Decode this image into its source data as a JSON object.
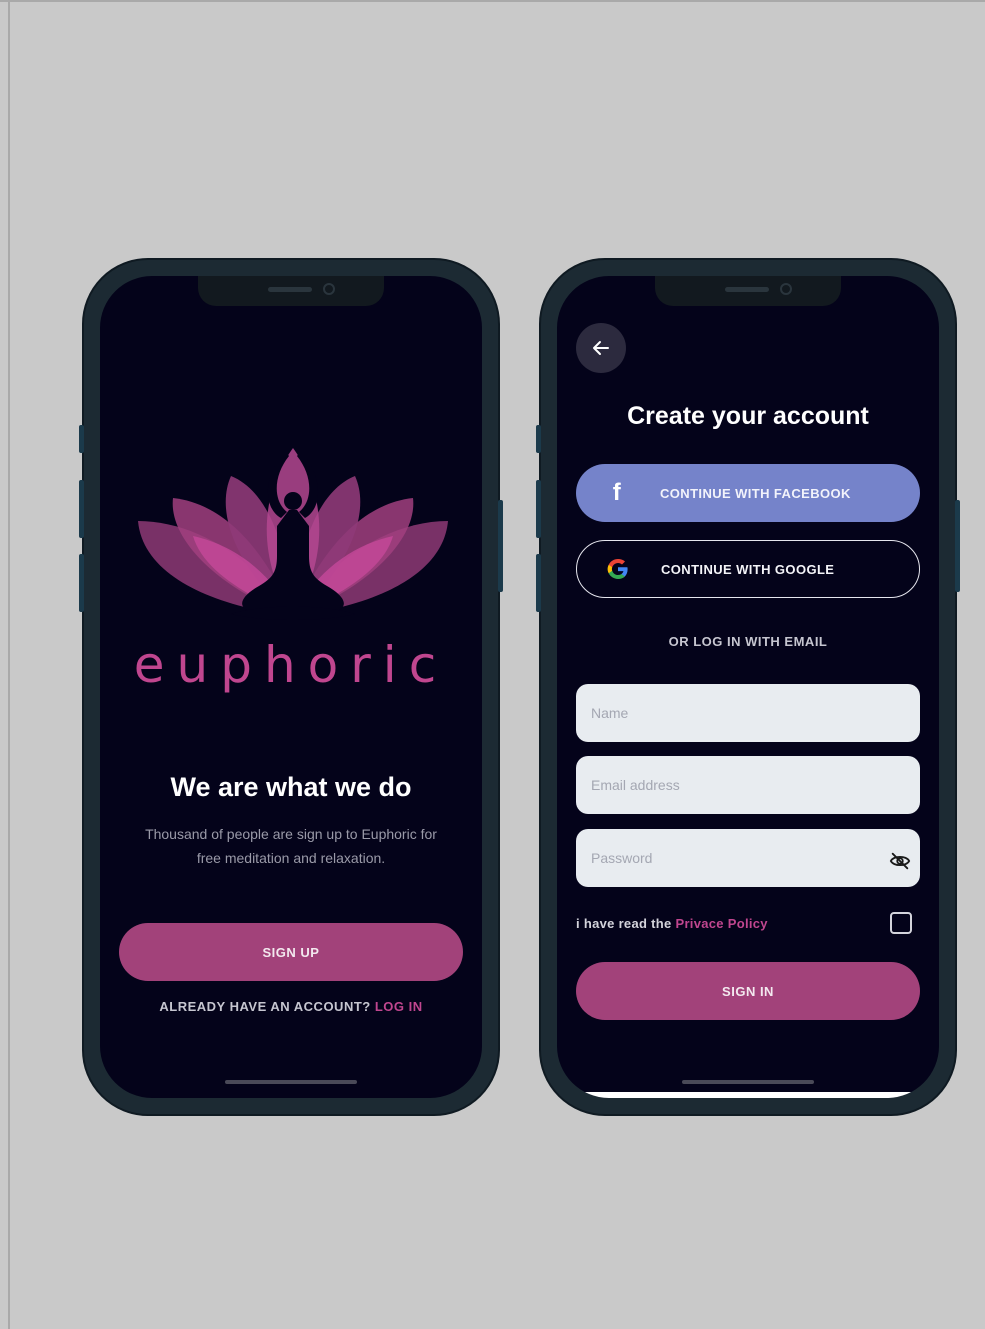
{
  "welcome_screen": {
    "brand_name": "euphoric",
    "tagline": "We are what we do",
    "description": "Thousand of people are sign up to Euphoric for free meditation and relaxation.",
    "signup_label": "SIGN UP",
    "already_text": "ALREADY HAVE AN ACCOUNT?",
    "login_link": "LOG IN"
  },
  "signup_screen": {
    "back_icon": "arrow-left-icon",
    "title": "Create your account",
    "facebook_label": "CONTINUE WITH FACEBOOK",
    "google_label": "CONTINUE WITH GOOGLE",
    "or_text": "OR LOG IN WITH EMAIL",
    "name_placeholder": "Name",
    "email_placeholder": "Email address",
    "password_placeholder": "Password",
    "policy_text": "i have read the",
    "policy_link": "Privace Policy",
    "signin_label": "SIGN IN"
  },
  "colors": {
    "background": "#c9c9c9",
    "screen": "#04031a",
    "accent": "#a2427a",
    "brand": "#c0468f",
    "facebook": "#7583ca"
  }
}
